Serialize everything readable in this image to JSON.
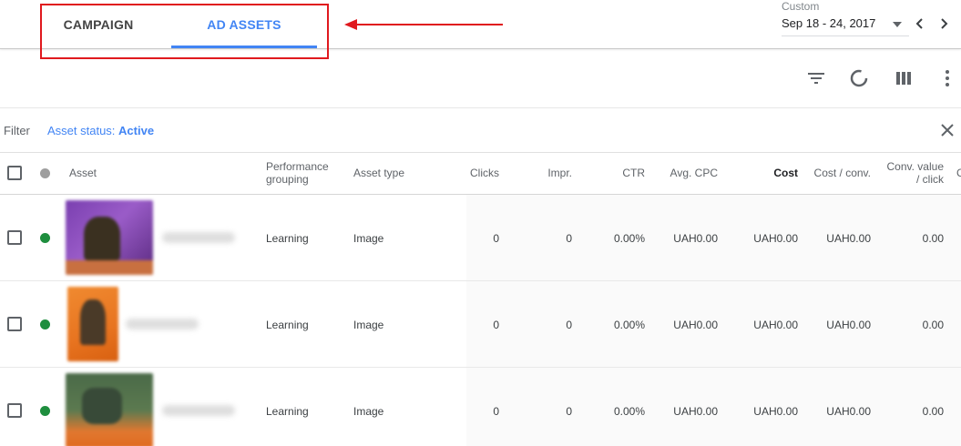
{
  "tabs": [
    {
      "label": "CAMPAIGN",
      "active": false
    },
    {
      "label": "AD ASSETS",
      "active": true
    }
  ],
  "date_range": {
    "label": "Custom",
    "value": "Sep 18 - 24, 2017"
  },
  "filter": {
    "label": "Filter",
    "chip_key": "Asset status:",
    "chip_value": "Active"
  },
  "columns": {
    "asset": "Asset",
    "performance_line1": "Performance",
    "performance_line2": "grouping",
    "asset_type": "Asset type",
    "clicks": "Clicks",
    "impr": "Impr.",
    "ctr": "CTR",
    "avg_cpc": "Avg. CPC",
    "cost": "Cost",
    "cost_conv": "Cost / conv.",
    "conv_value_line1": "Conv. value",
    "conv_value_line2": "/ click",
    "cut": "C"
  },
  "rows": [
    {
      "performance": "Learning",
      "type": "Image",
      "clicks": "0",
      "impr": "0",
      "ctr": "0.00%",
      "avg_cpc": "UAH0.00",
      "cost": "UAH0.00",
      "cost_conv": "UAH0.00",
      "conv_value": "0.00",
      "status_color": "#1e8e3e"
    },
    {
      "performance": "Learning",
      "type": "Image",
      "clicks": "0",
      "impr": "0",
      "ctr": "0.00%",
      "avg_cpc": "UAH0.00",
      "cost": "UAH0.00",
      "cost_conv": "UAH0.00",
      "conv_value": "0.00",
      "status_color": "#1e8e3e"
    },
    {
      "performance": "Learning",
      "type": "Image",
      "clicks": "0",
      "impr": "0",
      "ctr": "0.00%",
      "avg_cpc": "UAH0.00",
      "cost": "UAH0.00",
      "cost_conv": "UAH0.00",
      "conv_value": "0.00",
      "status_color": "#1e8e3e"
    }
  ],
  "colors": {
    "accent": "#4285f4",
    "annotation": "#e0191e",
    "status_active": "#1e8e3e"
  }
}
